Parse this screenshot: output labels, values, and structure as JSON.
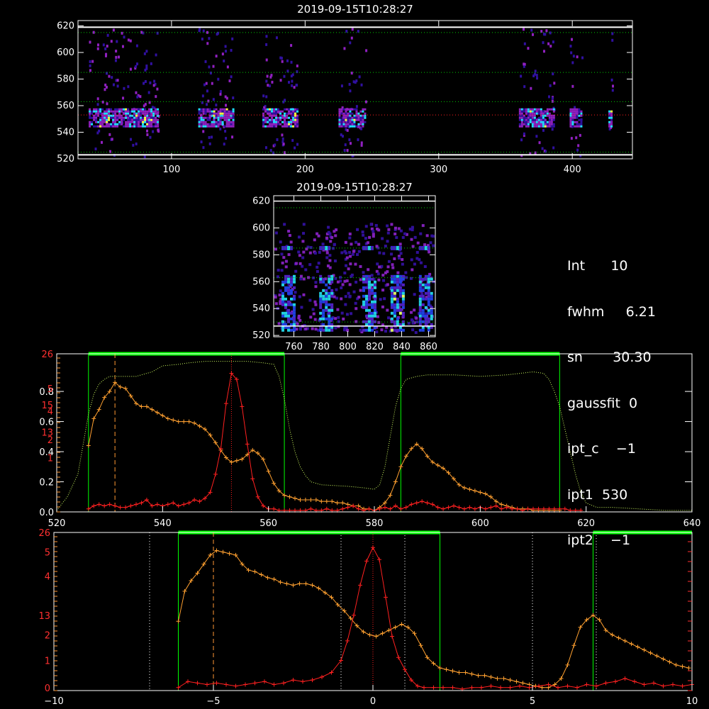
{
  "chart_data": [
    {
      "type": "heatmap",
      "title": "2019-09-15T10:28:27",
      "xlim": [
        30,
        445
      ],
      "ylim": [
        520,
        624
      ],
      "xticks": [
        100,
        200,
        300,
        400
      ],
      "yticks": [
        520,
        540,
        560,
        580,
        600,
        620
      ],
      "hlines_dotted": [
        {
          "y": 615,
          "color": "#00cc00"
        },
        {
          "y": 585,
          "color": "#00cc00"
        },
        {
          "y": 563,
          "color": "#00cc00"
        },
        {
          "y": 553,
          "color": "#ff2020"
        },
        {
          "y": 525,
          "color": "#00cc00"
        }
      ],
      "hlines_solid": [
        619,
        523
      ],
      "data_blocks_x": [
        [
          38,
          90
        ],
        [
          120,
          147
        ],
        [
          168,
          195
        ],
        [
          225,
          245
        ],
        [
          360,
          386
        ],
        [
          398,
          407
        ],
        [
          427,
          430
        ]
      ],
      "emission_band_y": [
        545,
        558
      ],
      "colors": {
        "low": "#3010a0",
        "mid": "#9020c0",
        "high": "#20e0ff",
        "peak": "#ffff40"
      }
    },
    {
      "type": "heatmap",
      "title": "2019-09-15T10:28:27",
      "xlim": [
        745,
        865
      ],
      "ylim": [
        519,
        624
      ],
      "xticks": [
        760,
        780,
        800,
        820,
        840,
        860
      ],
      "yticks": [
        520,
        540,
        560,
        580,
        600,
        620
      ],
      "hlines_dotted": [
        {
          "y": 615,
          "color": "#00cc00"
        },
        {
          "y": 585,
          "color": "#00cc00"
        },
        {
          "y": 563,
          "color": "#00cc00"
        },
        {
          "y": 530,
          "color": "#00cc00"
        }
      ],
      "hlines_solid": [
        620,
        527
      ],
      "bright_columns_x": [
        755,
        783,
        815,
        836,
        857
      ],
      "spot_y": 585
    },
    {
      "type": "line",
      "xlim": [
        520,
        640
      ],
      "xticks": [
        520,
        540,
        560,
        580,
        600,
        620,
        640
      ],
      "left_axis_white": {
        "ylim": [
          0,
          1.05
        ],
        "ticks": [
          "0.0",
          "0.2",
          "0.4",
          "0.6",
          "0.8"
        ],
        "tick_values": [
          0,
          0.2,
          0.4,
          0.6,
          0.8
        ]
      },
      "left_axis_red": {
        "labels": [
          "26",
          "5",
          "4",
          "2",
          "1"
        ],
        "label_values": [
          1.05,
          0.82,
          0.67,
          0.48,
          0.36
        ],
        "extra": [
          {
            "text": "15",
            "value": 0.71
          },
          {
            "text": "13",
            "value": 0.53
          }
        ]
      },
      "green_windows_x": [
        [
          526,
          563
        ],
        [
          585,
          615
        ]
      ],
      "vlines": [
        {
          "x": 531,
          "color": "#ff9933",
          "style": "dashed"
        },
        {
          "x": 553,
          "color": "#ff2020",
          "style": "dotted"
        }
      ],
      "series": [
        {
          "color": "#ffa030",
          "x": [
            526,
            527,
            528,
            529,
            530,
            531,
            532,
            533,
            534,
            535,
            536,
            537,
            538,
            539,
            540,
            541,
            542,
            543,
            544,
            545,
            546,
            547,
            548,
            549,
            550,
            551,
            552,
            553,
            554,
            555,
            556,
            557,
            558,
            559,
            560,
            561,
            562,
            563,
            564,
            565,
            566,
            567,
            568,
            569,
            570,
            571,
            572,
            573,
            574,
            575,
            576,
            577,
            578,
            579,
            580,
            581,
            582,
            583,
            584,
            585,
            586,
            587,
            588,
            589,
            590,
            591,
            592,
            593,
            594,
            595,
            596,
            597,
            598,
            599,
            600,
            601,
            602,
            603,
            604,
            605,
            606,
            607,
            608,
            609,
            610,
            611,
            612,
            613,
            614,
            615
          ],
          "y": [
            0.44,
            0.62,
            0.68,
            0.76,
            0.8,
            0.86,
            0.83,
            0.82,
            0.77,
            0.72,
            0.7,
            0.7,
            0.68,
            0.66,
            0.64,
            0.62,
            0.61,
            0.6,
            0.6,
            0.6,
            0.59,
            0.57,
            0.55,
            0.51,
            0.46,
            0.41,
            0.36,
            0.33,
            0.34,
            0.35,
            0.38,
            0.41,
            0.39,
            0.35,
            0.27,
            0.19,
            0.14,
            0.11,
            0.1,
            0.09,
            0.08,
            0.08,
            0.08,
            0.08,
            0.07,
            0.07,
            0.07,
            0.06,
            0.06,
            0.05,
            0.04,
            0.04,
            0.02,
            0.02,
            0.01,
            0.03,
            0.06,
            0.11,
            0.2,
            0.3,
            0.37,
            0.42,
            0.45,
            0.42,
            0.37,
            0.33,
            0.31,
            0.29,
            0.26,
            0.22,
            0.18,
            0.16,
            0.15,
            0.14,
            0.13,
            0.12,
            0.1,
            0.07,
            0.05,
            0.04,
            0.03,
            0.02,
            0.02,
            0.02,
            0.01,
            0.01,
            0.01,
            0.01,
            0.01,
            0.01
          ]
        },
        {
          "color": "#ff2020",
          "x": [
            526,
            527,
            528,
            529,
            530,
            531,
            532,
            533,
            534,
            535,
            536,
            537,
            538,
            539,
            540,
            541,
            542,
            543,
            544,
            545,
            546,
            547,
            548,
            549,
            550,
            551,
            552,
            553,
            554,
            555,
            556,
            557,
            558,
            559,
            560,
            561,
            562,
            563,
            564,
            565,
            566,
            567,
            568,
            569,
            570,
            571,
            572,
            573,
            574,
            575,
            576,
            577,
            578,
            579,
            580,
            581,
            582,
            583,
            584,
            585,
            586,
            587,
            588,
            589,
            590,
            591,
            592,
            593,
            594,
            595,
            596,
            597,
            598,
            599,
            600,
            601,
            602,
            603,
            604,
            605,
            606,
            607,
            608,
            609,
            610,
            611,
            612,
            613,
            614,
            615,
            616,
            617,
            618,
            619
          ],
          "y": [
            0.02,
            0.04,
            0.05,
            0.04,
            0.05,
            0.04,
            0.03,
            0.03,
            0.04,
            0.05,
            0.06,
            0.08,
            0.04,
            0.05,
            0.04,
            0.05,
            0.06,
            0.04,
            0.05,
            0.06,
            0.08,
            0.07,
            0.09,
            0.13,
            0.25,
            0.42,
            0.72,
            0.92,
            0.88,
            0.7,
            0.45,
            0.22,
            0.1,
            0.04,
            0.02,
            0.02,
            0.01,
            0.01,
            0.01,
            0.01,
            0.01,
            0.01,
            0.02,
            0.01,
            0.01,
            0.02,
            0.01,
            0.01,
            0.02,
            0.03,
            0.04,
            0.02,
            0.01,
            0.02,
            0.01,
            0.02,
            0.03,
            0.02,
            0.04,
            0.02,
            0.03,
            0.05,
            0.06,
            0.07,
            0.06,
            0.05,
            0.03,
            0.02,
            0.03,
            0.04,
            0.03,
            0.02,
            0.03,
            0.02,
            0.03,
            0.02,
            0.03,
            0.04,
            0.02,
            0.03,
            0.02,
            0.02,
            0.01,
            0.02,
            0.02,
            0.02,
            0.02,
            0.02,
            0.02,
            0.02,
            0.02,
            0.01,
            0.01,
            0.01
          ]
        },
        {
          "color": "#d0ff60",
          "style": "dotted",
          "x": [
            520,
            522,
            524,
            525,
            526,
            527,
            528,
            529,
            530,
            532,
            535,
            538,
            540,
            543,
            545,
            548,
            550,
            553,
            556,
            559,
            561,
            562,
            563,
            564,
            565,
            566,
            567,
            568,
            570,
            575,
            578,
            580,
            581,
            582,
            583,
            584,
            585,
            586,
            588,
            590,
            595,
            600,
            605,
            610,
            612,
            613,
            614,
            615,
            616,
            617,
            618,
            619,
            620,
            622,
            625,
            630,
            635,
            640
          ],
          "y": [
            0.01,
            0.1,
            0.25,
            0.45,
            0.65,
            0.78,
            0.85,
            0.88,
            0.9,
            0.9,
            0.9,
            0.93,
            0.97,
            0.98,
            0.99,
            1.0,
            1.0,
            1.0,
            1.0,
            0.99,
            0.98,
            0.9,
            0.75,
            0.55,
            0.4,
            0.3,
            0.24,
            0.2,
            0.18,
            0.17,
            0.16,
            0.15,
            0.18,
            0.3,
            0.5,
            0.7,
            0.82,
            0.88,
            0.9,
            0.91,
            0.91,
            0.9,
            0.91,
            0.93,
            0.92,
            0.88,
            0.8,
            0.7,
            0.55,
            0.4,
            0.25,
            0.13,
            0.06,
            0.03,
            0.03,
            0.02,
            0.01,
            0.01
          ]
        }
      ]
    },
    {
      "type": "line",
      "xlim": [
        -10,
        10
      ],
      "xticks": [
        -10,
        -5,
        0,
        5,
        10
      ],
      "left_axis_red": {
        "labels": [
          "26",
          "5",
          "4",
          "2",
          "1",
          "0"
        ],
        "label_values": [
          1.05,
          0.92,
          0.76,
          0.37,
          0.2,
          0.02
        ],
        "extra": [
          {
            "text": "13",
            "value": 0.5
          }
        ]
      },
      "green_windows_x": [
        [
          -6.1,
          2.1
        ],
        [
          6.9,
          10
        ]
      ],
      "vlines_dotted_white": [
        -7,
        -1,
        1,
        5,
        7
      ],
      "vlines": [
        {
          "x": -5,
          "color": "#ff9933",
          "style": "dashed"
        },
        {
          "x": 0,
          "color": "#ff2020",
          "style": "dotted"
        }
      ],
      "series": [
        {
          "color": "#ffa030",
          "x": [
            -6.1,
            -5.9,
            -5.7,
            -5.5,
            -5.3,
            -5.1,
            -4.9,
            -4.7,
            -4.5,
            -4.3,
            -4.1,
            -3.9,
            -3.7,
            -3.5,
            -3.3,
            -3.1,
            -2.9,
            -2.7,
            -2.5,
            -2.3,
            -2.1,
            -1.9,
            -1.7,
            -1.5,
            -1.3,
            -1.1,
            -0.9,
            -0.7,
            -0.5,
            -0.3,
            -0.1,
            0.1,
            0.3,
            0.5,
            0.7,
            0.9,
            1.1,
            1.3,
            1.5,
            1.7,
            1.9,
            2.1,
            2.3,
            2.5,
            2.7,
            2.9,
            3.1,
            3.3,
            3.5,
            3.7,
            3.9,
            4.1,
            4.3,
            4.5,
            4.7,
            4.9,
            5.1,
            5.3,
            5.5,
            5.7,
            5.9,
            6.1,
            6.3,
            6.5,
            6.7,
            6.9,
            7.1,
            7.3,
            7.5,
            7.7,
            7.9,
            8.1,
            8.3,
            8.5,
            8.7,
            8.9,
            9.1,
            9.3,
            9.5,
            9.7,
            9.9
          ],
          "y": [
            0.46,
            0.66,
            0.73,
            0.78,
            0.84,
            0.9,
            0.93,
            0.92,
            0.91,
            0.9,
            0.84,
            0.8,
            0.79,
            0.77,
            0.75,
            0.74,
            0.72,
            0.71,
            0.7,
            0.71,
            0.71,
            0.7,
            0.68,
            0.65,
            0.62,
            0.57,
            0.53,
            0.48,
            0.43,
            0.39,
            0.37,
            0.36,
            0.38,
            0.4,
            0.42,
            0.44,
            0.42,
            0.38,
            0.3,
            0.22,
            0.18,
            0.15,
            0.14,
            0.13,
            0.12,
            0.12,
            0.11,
            0.1,
            0.1,
            0.09,
            0.08,
            0.08,
            0.07,
            0.06,
            0.05,
            0.04,
            0.03,
            0.02,
            0.02,
            0.04,
            0.08,
            0.17,
            0.3,
            0.42,
            0.47,
            0.5,
            0.47,
            0.4,
            0.37,
            0.35,
            0.33,
            0.31,
            0.29,
            0.27,
            0.25,
            0.23,
            0.21,
            0.19,
            0.17,
            0.16,
            0.15
          ]
        },
        {
          "color": "#ff2020",
          "x": [
            -6.1,
            -5.8,
            -5.5,
            -5.2,
            -4.9,
            -4.6,
            -4.3,
            -4.0,
            -3.7,
            -3.4,
            -3.1,
            -2.8,
            -2.5,
            -2.2,
            -1.9,
            -1.6,
            -1.3,
            -1.0,
            -0.8,
            -0.6,
            -0.4,
            -0.2,
            0.0,
            0.2,
            0.4,
            0.6,
            0.8,
            1.0,
            1.2,
            1.4,
            1.6,
            1.9,
            2.2,
            2.5,
            2.8,
            3.1,
            3.4,
            3.7,
            4.0,
            4.3,
            4.6,
            4.9,
            5.2,
            5.5,
            5.8,
            6.1,
            6.4,
            6.7,
            7.0,
            7.3,
            7.6,
            7.9,
            8.2,
            8.5,
            8.8,
            9.1,
            9.4,
            9.7,
            10.0
          ],
          "y": [
            0.02,
            0.06,
            0.05,
            0.04,
            0.05,
            0.04,
            0.03,
            0.04,
            0.05,
            0.06,
            0.04,
            0.05,
            0.07,
            0.06,
            0.07,
            0.09,
            0.12,
            0.2,
            0.33,
            0.5,
            0.7,
            0.86,
            0.95,
            0.87,
            0.62,
            0.36,
            0.22,
            0.14,
            0.07,
            0.03,
            0.02,
            0.02,
            0.02,
            0.02,
            0.01,
            0.02,
            0.02,
            0.03,
            0.02,
            0.02,
            0.03,
            0.02,
            0.03,
            0.04,
            0.02,
            0.03,
            0.02,
            0.04,
            0.03,
            0.05,
            0.06,
            0.08,
            0.06,
            0.04,
            0.05,
            0.03,
            0.04,
            0.03,
            0.04
          ]
        }
      ]
    }
  ],
  "info": {
    "lines": [
      "Int      10",
      "fwhm     6.21",
      "sn       30.30",
      "gaussfit  0",
      "ipt_c    −1",
      "ipt1  530",
      "ipt2    −1"
    ]
  }
}
